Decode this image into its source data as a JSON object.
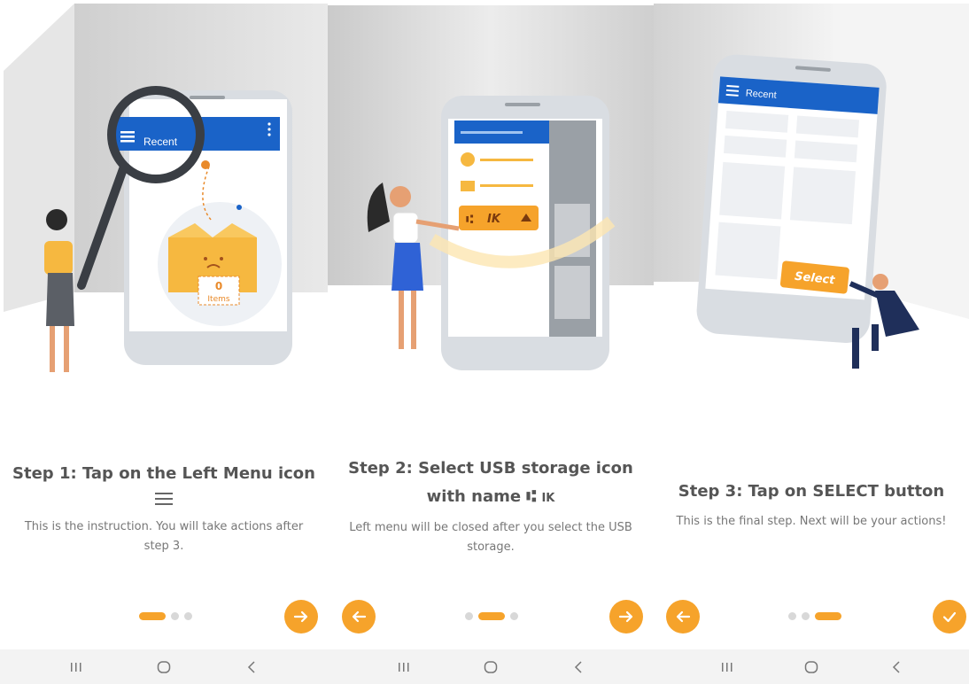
{
  "steps": [
    {
      "title": "Step 1: Tap on the Left Menu icon",
      "title_icon": "menu-icon",
      "description": "This is the instruction. You will take actions after step 3.",
      "illustration": {
        "toolbar_title": "Recent",
        "box_count": "0",
        "box_label": "Items"
      },
      "active_dot": 0,
      "next_icon": "arrow-right-icon"
    },
    {
      "title": "Step 2: Select USB storage icon",
      "title_line2": "with name",
      "title_icon": "usb-icon",
      "title_icon_text": "IK",
      "description": "Left menu will be closed after you select the USB storage.",
      "illustration": {
        "usb_label": "IK"
      },
      "active_dot": 1,
      "prev_icon": "arrow-left-icon",
      "next_icon": "arrow-right-icon"
    },
    {
      "title": "Step 3: Tap on SELECT button",
      "description": "This is the final step. Next will be your actions!",
      "illustration": {
        "toolbar_title": "Recent",
        "select_label": "Select"
      },
      "active_dot": 2,
      "prev_icon": "arrow-left-icon",
      "done_icon": "check-icon"
    }
  ],
  "system_nav": {
    "icons": [
      "recent-apps-icon",
      "home-icon",
      "back-icon"
    ]
  },
  "colors": {
    "accent": "#f6a32b",
    "app_bar": "#1a63c8",
    "text_title": "#555555",
    "text_desc": "#777777"
  }
}
